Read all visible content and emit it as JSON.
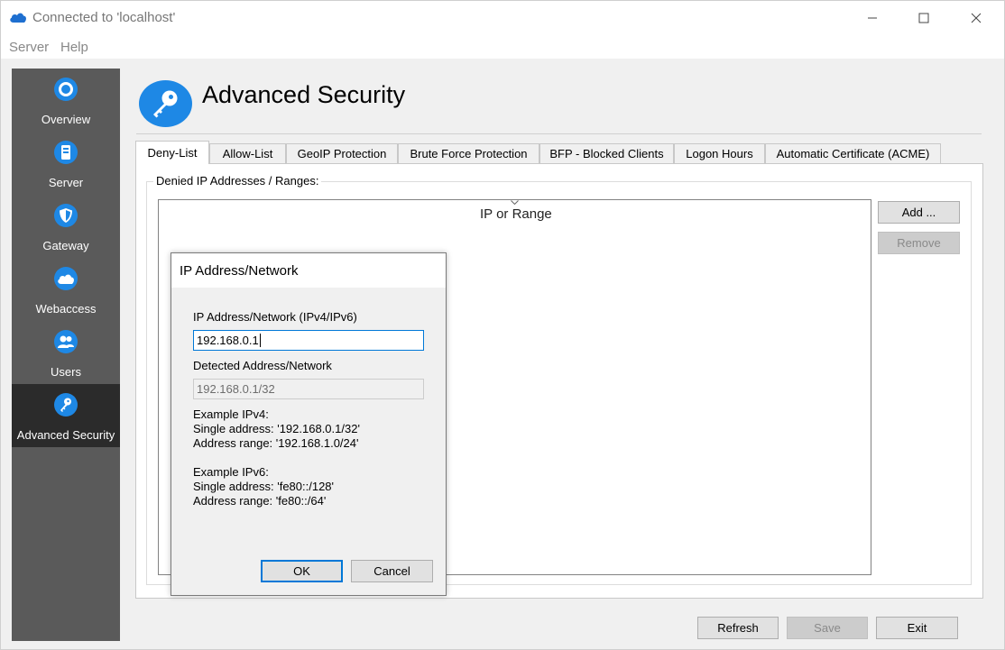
{
  "window": {
    "title": "Connected to 'localhost'",
    "minimize_label": "—",
    "maximize_label": "☐",
    "close_label": "✕"
  },
  "menu": {
    "items": [
      "Server",
      "Help"
    ]
  },
  "sidebar": {
    "items": [
      {
        "label": "Overview",
        "icon": "overview-icon"
      },
      {
        "label": "Server",
        "icon": "server-icon"
      },
      {
        "label": "Gateway",
        "icon": "shield-icon"
      },
      {
        "label": "Webaccess",
        "icon": "cloud-icon"
      },
      {
        "label": "Users",
        "icon": "users-icon"
      },
      {
        "label": "Advanced Security",
        "icon": "key-icon",
        "active": true
      }
    ]
  },
  "header": {
    "title": "Advanced Security",
    "icon": "key-icon"
  },
  "tabs": [
    {
      "label": "Deny-List",
      "active": true
    },
    {
      "label": "Allow-List"
    },
    {
      "label": "GeoIP Protection"
    },
    {
      "label": "Brute Force Protection"
    },
    {
      "label": "BFP - Blocked Clients"
    },
    {
      "label": "Logon Hours"
    },
    {
      "label": "Automatic Certificate (ACME)"
    }
  ],
  "deny_list": {
    "group_label": "Denied  IP Addresses / Ranges:",
    "column_header": "IP or Range",
    "add_label": "Add ...",
    "remove_label": "Remove"
  },
  "footer": {
    "refresh_label": "Refresh",
    "save_label": "Save",
    "exit_label": "Exit"
  },
  "dialog": {
    "title": "IP Address/Network",
    "input_label": "IP Address/Network (IPv4/IPv6)",
    "input_value": "192.168.0.1",
    "detected_label": "Detected Address/Network",
    "detected_value": "192.168.0.1/32",
    "ipv4_heading": "Example IPv4:",
    "ipv4_single": "Single address: '192.168.0.1/32'",
    "ipv4_range": "Address range: '192.168.1.0/24'",
    "ipv6_heading": "Example IPv6:",
    "ipv6_single": "Single address: 'fe80::/128'",
    "ipv6_range": "Address range: 'fe80::/64'",
    "ok_label": "OK",
    "cancel_label": "Cancel"
  },
  "colors": {
    "accent": "#1e88e5",
    "sidebar_bg": "#5a5a5a",
    "sidebar_active_bg": "#2b2b2b",
    "focus_border": "#0078d7"
  }
}
